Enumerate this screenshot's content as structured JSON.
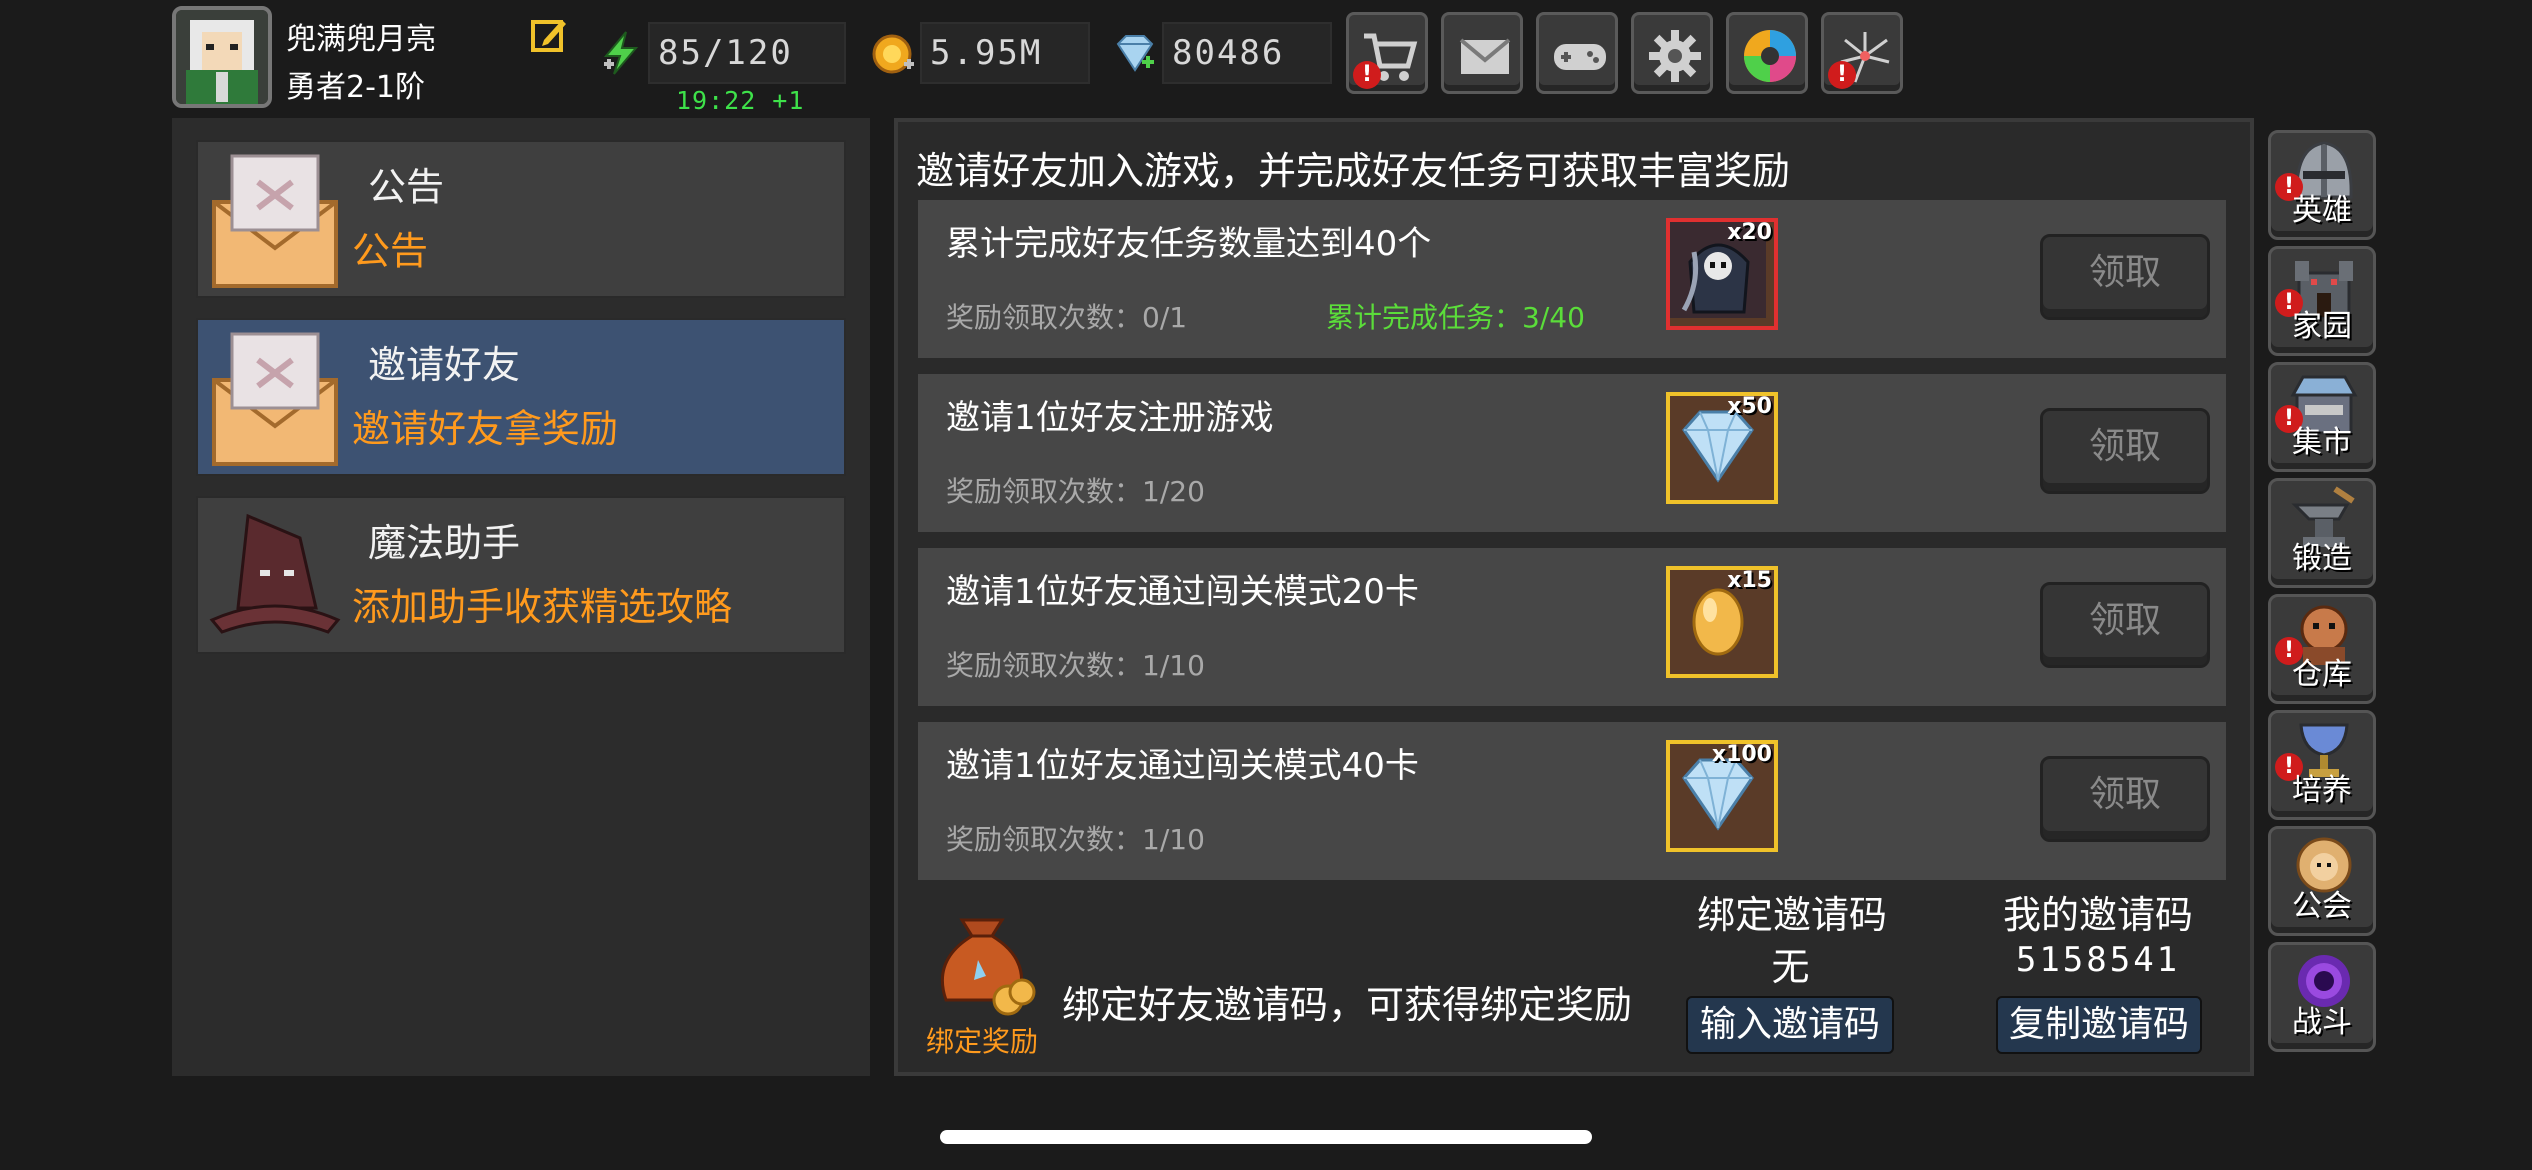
{
  "player": {
    "name": "兜满兜月亮",
    "rank": "勇者2-1阶"
  },
  "stats": {
    "energy": "85/120",
    "energy_timer": "19:22 +1",
    "gold": "5.95M",
    "gems": "80486"
  },
  "top_buttons": [
    {
      "icon": "cart-icon",
      "alert": true
    },
    {
      "icon": "mail-icon",
      "alert": false
    },
    {
      "icon": "gamepad-icon",
      "alert": false
    },
    {
      "icon": "gear-icon",
      "alert": false
    },
    {
      "icon": "aperture-icon",
      "alert": false
    },
    {
      "icon": "fireworks-icon",
      "alert": true
    }
  ],
  "alert_mark": "!",
  "menu": [
    {
      "title": "公告",
      "subtitle": "公告",
      "icon": "envelope-icon",
      "active": false
    },
    {
      "title": "邀请好友",
      "subtitle": "邀请好友拿奖励",
      "icon": "envelope-icon",
      "active": true
    },
    {
      "title": "魔法助手",
      "subtitle": "添加助手收获精选攻略",
      "icon": "witch-hat-icon",
      "active": false
    }
  ],
  "main": {
    "header": "邀请好友加入游戏，并完成好友任务可获取丰富奖励",
    "tasks": [
      {
        "title": "累计完成好友任务数量达到40个",
        "count": "奖励领取次数：0/1",
        "progress": "累计完成任务：3/40",
        "reward_icon": "reaper-icon",
        "reward_qty": "x20",
        "claim": "领取"
      },
      {
        "title": "邀请1位好友注册游戏",
        "count": "奖励领取次数：1/20",
        "progress": "",
        "reward_icon": "diamond-icon",
        "reward_qty": "x50",
        "claim": "领取"
      },
      {
        "title": "邀请1位好友通过闯关模式20卡",
        "count": "奖励领取次数：1/10",
        "progress": "",
        "reward_icon": "golden-egg-icon",
        "reward_qty": "x15",
        "claim": "领取"
      },
      {
        "title": "邀请1位好友通过闯关模式40卡",
        "count": "奖励领取次数：1/10",
        "progress": "",
        "reward_icon": "diamond-icon",
        "reward_qty": "x100",
        "claim": "领取"
      }
    ],
    "bind": {
      "label": "绑定奖励",
      "text": "绑定好友邀请码，可获得绑定奖励",
      "bound_head": "绑定邀请码",
      "bound_value": "无",
      "input_btn": "输入邀请码",
      "my_head": "我的邀请码",
      "my_value": "5158541",
      "copy_btn": "复制邀请码"
    }
  },
  "side_nav": [
    {
      "label": "英雄",
      "icon": "helmet-icon",
      "alert": true
    },
    {
      "label": "家园",
      "icon": "castle-icon",
      "alert": true
    },
    {
      "label": "集市",
      "icon": "shop-icon",
      "alert": true
    },
    {
      "label": "锻造",
      "icon": "anvil-icon",
      "alert": false
    },
    {
      "label": "仓库",
      "icon": "warehouse-icon",
      "alert": true
    },
    {
      "label": "培养",
      "icon": "chalice-icon",
      "alert": true
    },
    {
      "label": "公会",
      "icon": "guild-icon",
      "alert": false
    },
    {
      "label": "战斗",
      "icon": "portal-icon",
      "alert": false
    }
  ],
  "colors": {
    "accent_orange": "#ff9a1d",
    "progress_green": "#5bdd3a",
    "timer_green": "#3ee24a",
    "active_tab": "#3d5272",
    "alert_red": "#d01c1c"
  }
}
